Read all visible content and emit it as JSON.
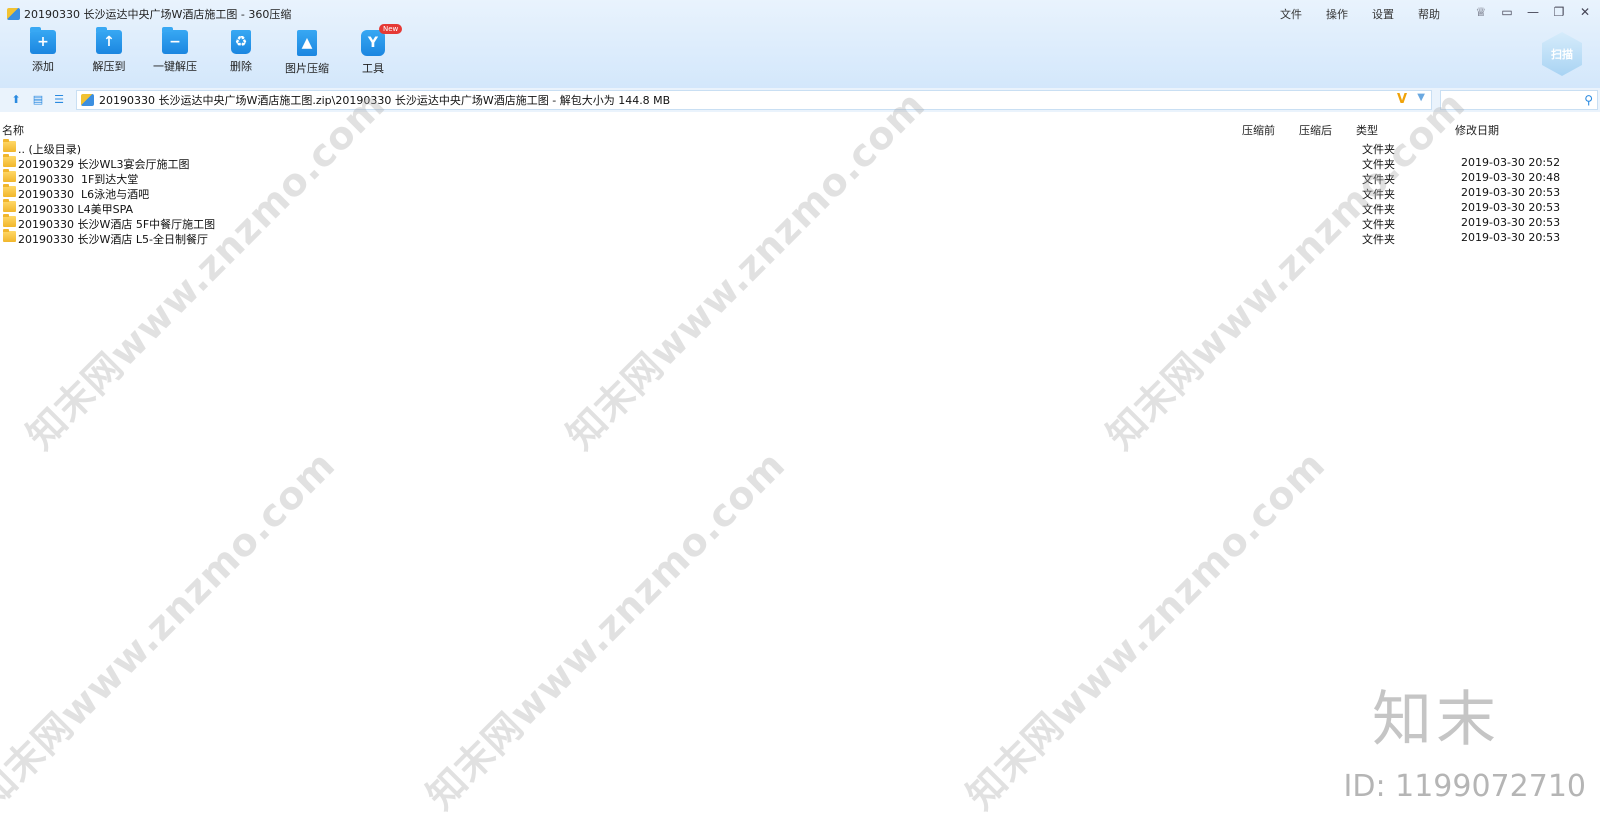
{
  "window": {
    "title": "20190330 长沙运达中央广场W酒店施工图 - 360压缩"
  },
  "menu": {
    "items": [
      "文件",
      "操作",
      "设置",
      "帮助"
    ]
  },
  "toolbar": {
    "add": "添加",
    "extract_to": "解压到",
    "one_click": "一键解压",
    "delete": "删除",
    "image_compress": "图片压缩",
    "tools": "工具",
    "new_badge": "New",
    "scan": "扫描"
  },
  "address": {
    "path": "20190330 长沙运达中央广场W酒店施工图.zip\\20190330 长沙运达中央广场W酒店施工图 - 解包大小为 144.8 MB",
    "v": "V"
  },
  "columns": {
    "name": "名称",
    "before": "压缩前",
    "after": "压缩后",
    "type": "类型",
    "date": "修改日期"
  },
  "rows": [
    {
      "name": ".. (上级目录)",
      "type": "文件夹",
      "date": ""
    },
    {
      "name": "20190329 长沙WL3宴会厅施工图",
      "type": "文件夹",
      "date": "2019-03-30 20:52"
    },
    {
      "name": "20190330  1F到达大堂",
      "type": "文件夹",
      "date": "2019-03-30 20:48"
    },
    {
      "name": "20190330  L6泳池与酒吧",
      "type": "文件夹",
      "date": "2019-03-30 20:53"
    },
    {
      "name": "20190330 L4美甲SPA",
      "type": "文件夹",
      "date": "2019-03-30 20:53"
    },
    {
      "name": "20190330 长沙W酒店 5F中餐厅施工图",
      "type": "文件夹",
      "date": "2019-03-30 20:53"
    },
    {
      "name": "20190330 长沙W酒店 L5-全日制餐厅",
      "type": "文件夹",
      "date": "2019-03-30 20:53"
    }
  ],
  "watermark": {
    "text": "知末网www.znzmo.com",
    "brand": "知末",
    "id": "ID: 1199072710"
  }
}
